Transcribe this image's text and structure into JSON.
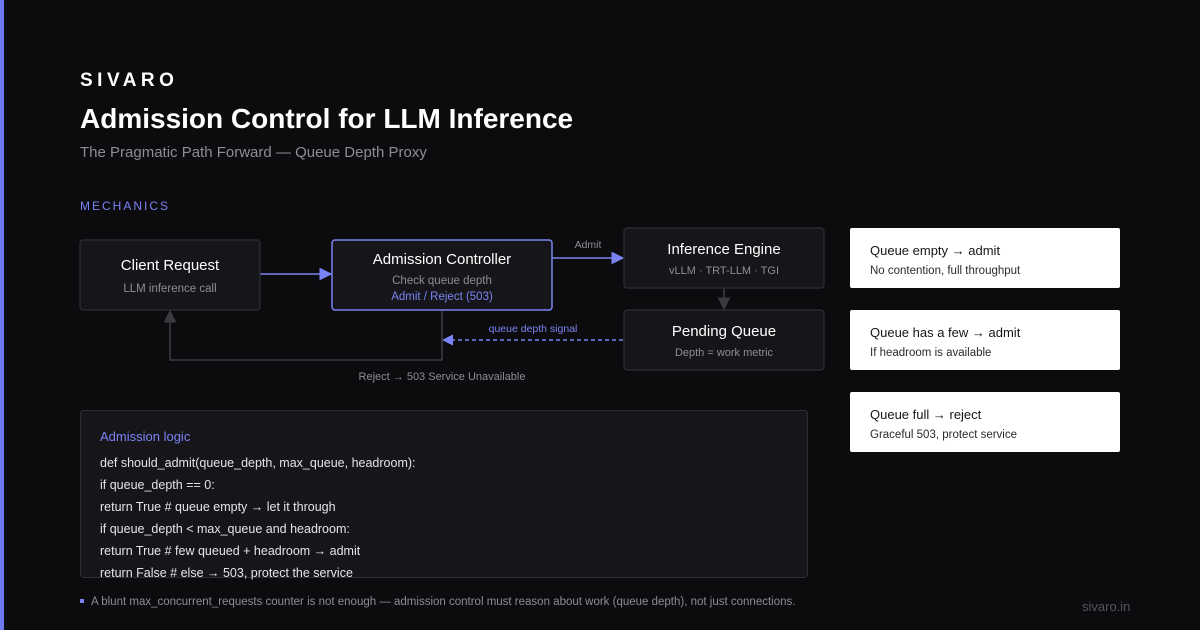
{
  "brand": "SIVARO",
  "title": "Admission Control for LLM Inference",
  "subtitle": "The Pragmatic Path Forward — Queue Depth Proxy",
  "section_label": "MECHANICS",
  "diagram": {
    "nodes": {
      "client": {
        "title": "Client Request",
        "sub": "LLM inference call"
      },
      "controller": {
        "title": "Admission Controller",
        "sub": "Check queue depth",
        "sub2": "Admit / Reject (503)"
      },
      "engine": {
        "title": "Inference Engine",
        "sub": "vLLM · TRT-LLM · TGI"
      },
      "queue": {
        "title": "Pending Queue",
        "sub": "Depth = work metric"
      }
    },
    "edges": {
      "admit": "Admit",
      "signal": "queue depth signal",
      "reject": "Reject → 503 Service Unavailable"
    }
  },
  "code": {
    "title": "Admission logic",
    "lines": [
      "def should_admit(queue_depth, max_queue, headroom):",
      "if queue_depth == 0:",
      "return True # queue empty → let it through",
      "if queue_depth < max_queue and headroom:",
      "return True # few queued + headroom → admit",
      "return False # else → 503, protect the service"
    ]
  },
  "cards": [
    {
      "title": "Queue empty → admit",
      "sub": "No contention, full throughput"
    },
    {
      "title": "Queue has a few → admit",
      "sub": "If headroom is available"
    },
    {
      "title": "Queue full → reject",
      "sub": "Graceful 503, protect service"
    }
  ],
  "footnote": "A blunt max_concurrent_requests counter is not enough — admission control must reason about work (queue depth), not just connections.",
  "site": "sivaro.in",
  "colors": {
    "accent": "#7b84f4",
    "background": "#0c0c0e",
    "node_fill": "#16161a",
    "node_border": "#2e2e34"
  }
}
